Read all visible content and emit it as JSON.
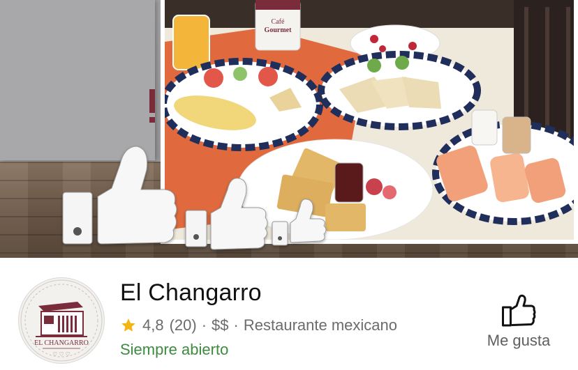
{
  "cover": {
    "bottle_label_line1": "Café",
    "bottle_label_line2": "Gourmet"
  },
  "business": {
    "name": "El Changarro",
    "logo_text": "EL CHANGARRO",
    "rating": "4,8",
    "review_count": "(20)",
    "price_level": "$$",
    "category": "Restaurante mexicano",
    "separator": "·",
    "status": "Siempre abierto"
  },
  "actions": {
    "like_label": "Me gusta"
  },
  "colors": {
    "status_green": "#3c8b3f",
    "star_gold": "#f2b511",
    "logo_maroon": "#7a2c3a"
  },
  "icons": {
    "rating": "star-icon",
    "like": "thumbs-up-icon",
    "cover_decoration": "thumbs-up-icon"
  }
}
